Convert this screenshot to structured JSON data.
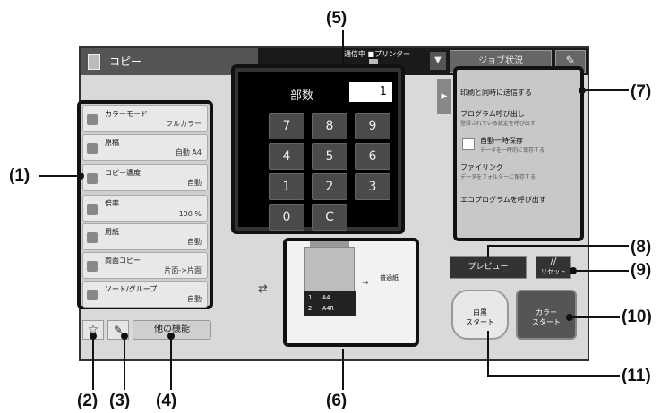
{
  "titlebar": {
    "title": "コピー",
    "status": "通信中 ■プリンター",
    "dropdown": "▼",
    "job_status": "ジョブ状況",
    "tool_icon": "wrench-icon"
  },
  "left_panel": {
    "items": [
      {
        "label": "カラーモード",
        "value": "フルカラー"
      },
      {
        "label": "原稿",
        "value": "自動 A4"
      },
      {
        "label": "コピー濃度",
        "value": "自動"
      },
      {
        "label": "倍率",
        "value": "100 %"
      },
      {
        "label": "用紙",
        "value": "自動"
      },
      {
        "label": "両面コピー",
        "value": "片面->片面"
      },
      {
        "label": "ソート/グループ",
        "value": "自動"
      }
    ]
  },
  "bottom_left": {
    "star_icon": "☆",
    "brush_icon": "✎",
    "other_functions": "他の機能"
  },
  "keypad": {
    "copies_label": "部数",
    "copies_value": "1",
    "keys": [
      "7",
      "8",
      "9",
      "4",
      "5",
      "6",
      "1",
      "2",
      "3",
      "0",
      "C"
    ]
  },
  "preview": {
    "tray1_no": "1",
    "tray1_size": "A4",
    "tray2_no": "2",
    "tray2_size": "A4R",
    "paper_type": "普通紙",
    "sides_icon": "⇄"
  },
  "right_panel": {
    "handle": "▶",
    "items": [
      {
        "label": "印刷と同時に送信する",
        "sub": ""
      },
      {
        "label": "プログラム呼び出し",
        "sub": "登録されている設定を呼び出す"
      },
      {
        "label": "自動一時保存",
        "sub": "データを一時的に保存する"
      },
      {
        "label": "ファイリング",
        "sub": "データをフォルダーに保存する"
      },
      {
        "label": "エコプログラムを呼び出す",
        "sub": ""
      }
    ]
  },
  "buttons": {
    "preview": "プレビュー",
    "reset_symbol": "//",
    "reset": "リセット",
    "bw_start_1": "白黒",
    "bw_start_2": "スタート",
    "color_start_1": "カラー",
    "color_start_2": "スタート"
  },
  "callouts": {
    "c1": "(1)",
    "c2": "(2)",
    "c3": "(3)",
    "c4": "(4)",
    "c5": "(5)",
    "c6": "(6)",
    "c7": "(7)",
    "c8": "(8)",
    "c9": "(9)",
    "c10": "(10)",
    "c11": "(11)"
  }
}
